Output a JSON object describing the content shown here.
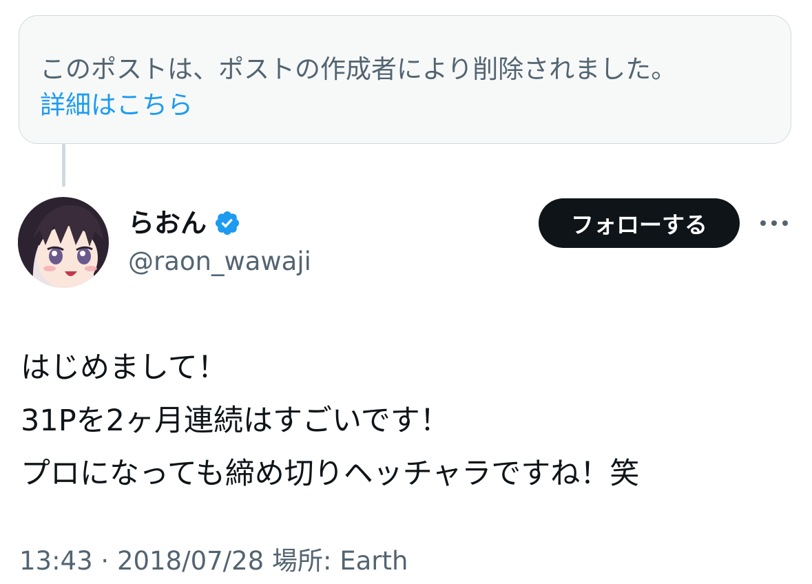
{
  "notice": {
    "message": "このポストは、ポストの作成者により削除されました。",
    "learn_more_link": "詳細はこちら"
  },
  "author": {
    "display_name": "らおん",
    "handle": "@raon_wawaji",
    "verified_icon": "verified-badge-icon",
    "avatar": "anime-girl-avatar"
  },
  "actions": {
    "follow_label": "フォローする",
    "more_icon": "more-dots-icon"
  },
  "tweet": {
    "lines": [
      "はじめまして！",
      "31Pを2ヶ月連続はすごいです！",
      "プロになっても締め切りヘッチャラですね！笑"
    ]
  },
  "meta": {
    "time": "13:43",
    "separator": "·",
    "date": "2018/07/28",
    "location_label": "場所:",
    "location": "Earth"
  },
  "colors": {
    "accent": "#1d9bf0",
    "verified": "#1d9bf0",
    "text_primary": "#0f1419",
    "text_secondary": "#536471",
    "notice_bg": "#f7f9f9",
    "border": "#cfd9de",
    "follow_bg": "#0f1419"
  }
}
